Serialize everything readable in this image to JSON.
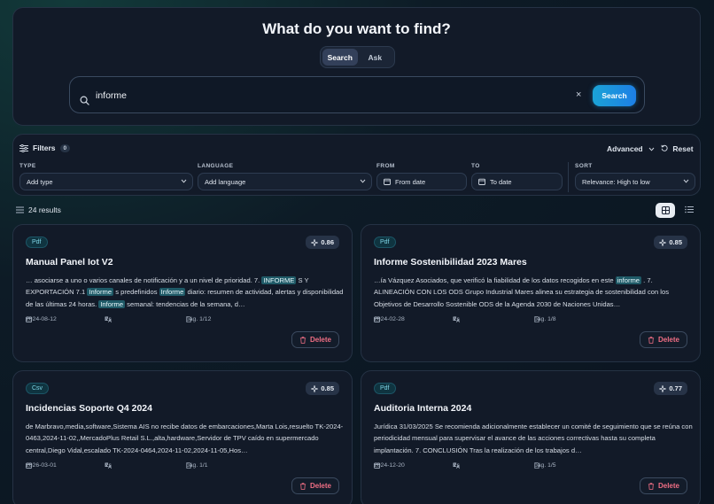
{
  "hero": {
    "title": "What do you want to find?",
    "modes": [
      "Search",
      "Ask"
    ],
    "active_mode": "Search",
    "query": "informe",
    "clear_label": "×",
    "search_button": "Search"
  },
  "filters": {
    "title": "Filters",
    "count": "0",
    "advanced_label": "Advanced",
    "reset_label": "Reset",
    "type": {
      "label": "TYPE",
      "placeholder": "Add type"
    },
    "language": {
      "label": "LANGUAGE",
      "placeholder": "Add language"
    },
    "from": {
      "label": "FROM",
      "placeholder": "From date"
    },
    "to": {
      "label": "TO",
      "placeholder": "To date"
    },
    "sort": {
      "label": "SORT",
      "value": "Relevance: High to low"
    }
  },
  "results": {
    "count_label": "24 results",
    "view_mode": "grid"
  },
  "cards": [
    {
      "type": "Pdf",
      "score": "0.86",
      "title": "Manual Panel Iot V2",
      "snippet": [
        {
          "t": "… asociarse a uno o varios canales de notificación y a un nivel de prioridad. 7. ",
          "h": false
        },
        {
          "t": "INFORME",
          "h": true
        },
        {
          "t": " S Y EXPORTACIÓN 7.1 ",
          "h": false
        },
        {
          "t": "Informe",
          "h": true
        },
        {
          "t": " s predefinidos ",
          "h": false
        },
        {
          "t": "Informe",
          "h": true
        },
        {
          "t": " diario: resumen de actividad, alertas y disponibilidad de las últimas 24 horas. ",
          "h": false
        },
        {
          "t": "Informe",
          "h": true
        },
        {
          "t": " semanal: tendencias de la semana, d…",
          "h": false
        }
      ],
      "date": "2024-08-12",
      "language": "Es",
      "pages": "pág. 1/12",
      "delete_label": "Delete"
    },
    {
      "type": "Pdf",
      "score": "0.85",
      "title": "Informe Sostenibilidad 2023 Mares",
      "snippet": [
        {
          "t": "…ía Vázquez Asociados, que verificó la fiabilidad de los datos recogidos en este ",
          "h": false
        },
        {
          "t": "informe",
          "h": true
        },
        {
          "t": " . 7. ALINEACIÓN CON LOS ODS Grupo Industrial Mares alinea su estrategia de sostenibilidad con los Objetivos de Desarrollo Sostenible ODS de la Agenda 2030 de Naciones Unidas…",
          "h": false
        }
      ],
      "date": "2024-02-28",
      "language": "Es",
      "pages": "pág. 1/8",
      "delete_label": "Delete"
    },
    {
      "type": "Csv",
      "score": "0.85",
      "title": "Incidencias Soporte Q4 2024",
      "snippet": [
        {
          "t": "de Marbravo,media,software,Sistema AIS no recibe datos de embarcaciones,Marta Lois,resuelto TK-2024-0463,2024-11-02,,MercadoPlus Retail S.L.,alta,hardware,Servidor de TPV caído en supermercado central,Diego Vidal,escalado TK-2024-0464,2024-11-02,2024-11-05,Hos…",
          "h": false
        }
      ],
      "date": "2026-03-01",
      "language": "Es",
      "pages": "pág. 1/1",
      "delete_label": "Delete"
    },
    {
      "type": "Pdf",
      "score": "0.77",
      "title": "Auditoria Interna 2024",
      "snippet": [
        {
          "t": "Jurídica 31/03/2025 Se recomienda adicionalmente establecer un comité de seguimiento que se reúna con periodicidad mensual para supervisar el avance de las acciones correctivas hasta su completa implantación. 7. CONCLUSIÓN Tras la realización de los trabajos d…",
          "h": false
        }
      ],
      "date": "2024-12-20",
      "language": "Es",
      "pages": "pág. 1/5",
      "delete_label": "Delete"
    }
  ]
}
